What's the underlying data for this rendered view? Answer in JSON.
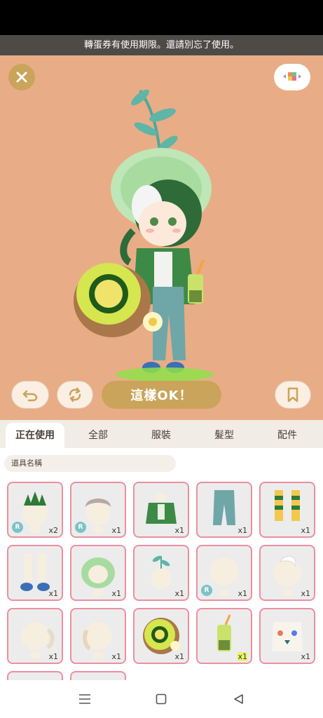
{
  "notice": {
    "text": "轉蛋券有使用期限。還請別忘了使用。"
  },
  "stage": {
    "close_icon": "close-icon",
    "layout_icon": "color-palette-icon",
    "undo_icon": "undo-icon",
    "random_icon": "shuffle-icon",
    "ok_label": "這樣OK！",
    "save_icon": "bookmark-icon"
  },
  "tabs": [
    {
      "label": "正在使用",
      "active": true
    },
    {
      "label": "全部"
    },
    {
      "label": "服裝"
    },
    {
      "label": "髮型"
    },
    {
      "label": "配件"
    }
  ],
  "search": {
    "placeholder": "道具名稱"
  },
  "items": [
    {
      "icon": "spiky-hair-icon",
      "qty": "x2",
      "badge": "R"
    },
    {
      "icon": "short-hair-icon",
      "qty": "x1",
      "badge": "R"
    },
    {
      "icon": "green-top-icon",
      "qty": "x1"
    },
    {
      "icon": "blue-jeans-icon",
      "qty": "x1"
    },
    {
      "icon": "striped-socks-icon",
      "qty": "x1"
    },
    {
      "icon": "sneakers-icon",
      "qty": "x1"
    },
    {
      "icon": "cabbage-hat-icon",
      "qty": "x1"
    },
    {
      "icon": "sprout-accessory-icon",
      "qty": "x1"
    },
    {
      "icon": "base-hair-icon",
      "qty": "x1",
      "badge": "R"
    },
    {
      "icon": "white-hair-icon",
      "qty": "x1"
    },
    {
      "icon": "ponytail-hair-icon",
      "qty": "x1"
    },
    {
      "icon": "curly-hair-icon",
      "qty": "x1"
    },
    {
      "icon": "kiwi-bag-icon",
      "qty": "x1"
    },
    {
      "icon": "bubble-tea-icon",
      "qty": "x1"
    },
    {
      "icon": "flower-collar-icon",
      "qty": "x1"
    }
  ],
  "navbar": {
    "menu_icon": "menu-icon",
    "home_icon": "home-icon",
    "back_icon": "back-icon"
  }
}
